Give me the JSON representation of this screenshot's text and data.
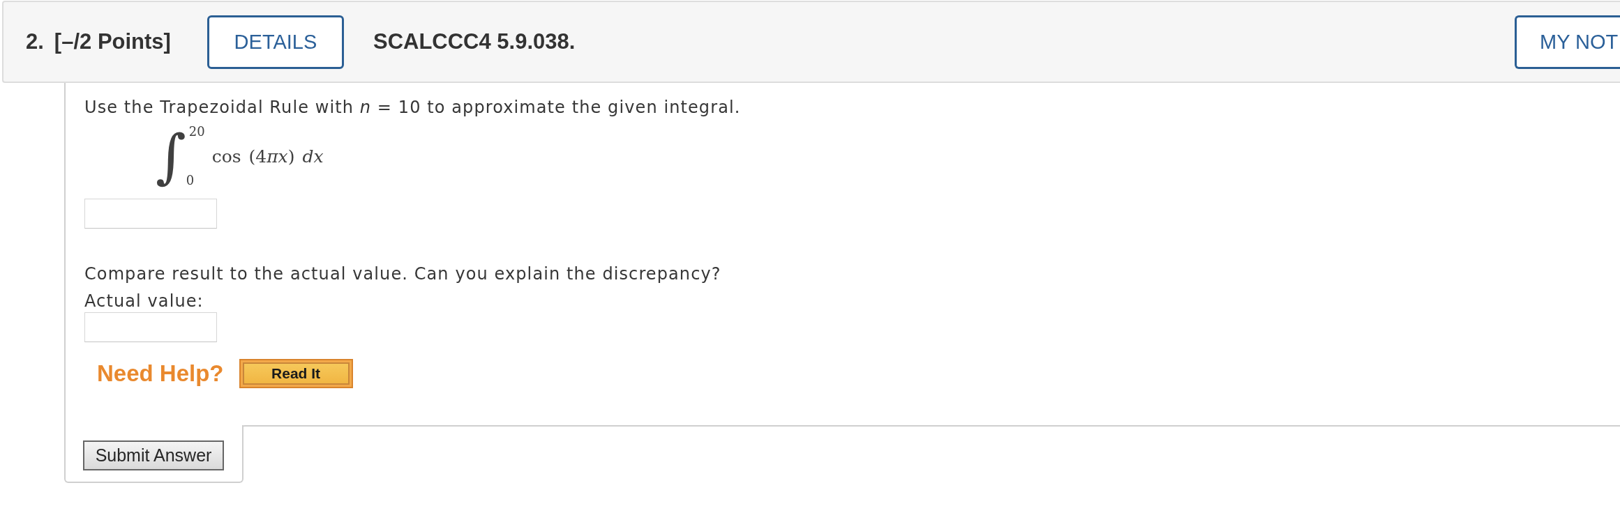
{
  "question": {
    "number": "2.",
    "points": "[–/2 Points]",
    "details_button": "DETAILS",
    "code": "SCALCCC4 5.9.038.",
    "notes_button": "MY NOT"
  },
  "parts": [
    {
      "kind": "text",
      "text": "Use the Trapezoidal Rule with *n* = 10 to approximate the given integral."
    },
    {
      "kind": "integral",
      "sign": "∫",
      "upper": "20",
      "lower": "0",
      "integrand": "cos (4⁠*πx*) *dx*"
    },
    {
      "kind": "answer"
    },
    {
      "kind": "text",
      "text": "Compare result to the actual value. Can you explain the discrepancy?"
    },
    {
      "kind": "text",
      "text": "Actual value:"
    },
    {
      "kind": "answer"
    }
  ],
  "help": {
    "label": "Need Help?",
    "buttons": [
      "Read It"
    ]
  },
  "submit_button": "Submit Answer"
}
